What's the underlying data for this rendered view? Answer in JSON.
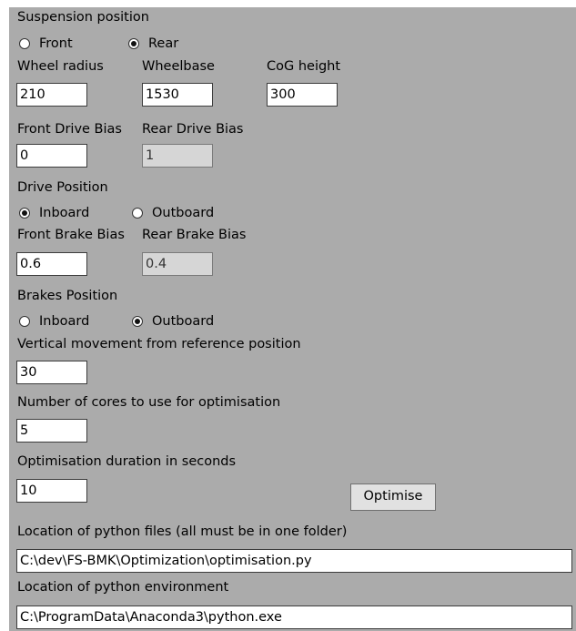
{
  "suspension": {
    "heading": "Suspension position",
    "options": [
      "Front",
      "Rear"
    ],
    "selected": "Rear"
  },
  "geometry": {
    "wheel_radius_label": "Wheel radius",
    "wheel_radius": "210",
    "wheelbase_label": "Wheelbase",
    "wheelbase": "1530",
    "cog_label": "CoG height",
    "cog": "300"
  },
  "drive_bias": {
    "front_label": "Front Drive Bias",
    "front": "0",
    "rear_label": "Rear Drive Bias",
    "rear": "1"
  },
  "drive_position": {
    "heading": "Drive Position",
    "options": [
      "Inboard",
      "Outboard"
    ],
    "selected": "Inboard"
  },
  "brake_bias": {
    "front_label": "Front Brake Bias",
    "front": "0.6",
    "rear_label": "Rear Brake Bias",
    "rear": "0.4"
  },
  "brakes_position": {
    "heading": "Brakes Position",
    "options": [
      "Inboard",
      "Outboard"
    ],
    "selected": "Outboard"
  },
  "vertical": {
    "label": "Vertical movement from reference position",
    "value": "30"
  },
  "cores": {
    "label": "Number of cores to use for optimisation",
    "value": "5"
  },
  "duration": {
    "label": "Optimisation duration in seconds",
    "value": "10"
  },
  "optimise_button": "Optimise",
  "python_files": {
    "label": "Location of python files (all must be in one folder)",
    "value": "C:\\dev\\FS-BMK\\Optimization\\optimisation.py"
  },
  "python_env": {
    "label": "Location of python environment",
    "value": "C:\\ProgramData\\Anaconda3\\python.exe"
  }
}
